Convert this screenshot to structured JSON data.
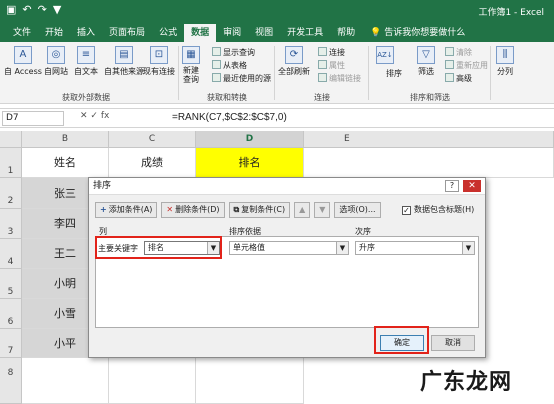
{
  "qat": {
    "save_icon": "save-icon",
    "undo_icon": "undo-icon",
    "redo_icon": "redo-icon",
    "filter_icon": "filter-icon"
  },
  "window": {
    "title": "工作簿1 - Excel"
  },
  "tabs": [
    "文件",
    "开始",
    "插入",
    "页面布局",
    "公式",
    "数据",
    "审阅",
    "视图",
    "开发工具",
    "帮助"
  ],
  "tell_me": "告诉我你想要做什么",
  "ribbon": {
    "get_external": {
      "items": [
        "自 Access",
        "自网站",
        "自文本",
        "自其他来源",
        "现有连接"
      ],
      "label": "获取外部数据"
    },
    "get_transform": {
      "new_query": "新建\n查询",
      "show_queries": "显示查询",
      "from_table": "从表格",
      "recent_sources": "最近使用的源",
      "label": "获取和转换"
    },
    "connections": {
      "refresh_all": "全部刷新",
      "connections": "连接",
      "properties": "属性",
      "edit_links": "编辑链接",
      "label": "连接"
    },
    "sort_filter": {
      "sort": "排序",
      "filter": "筛选",
      "clear": "清除",
      "reapply": "重新应用",
      "advanced": "高级",
      "label": "排序和筛选"
    },
    "split": "分列"
  },
  "formula_bar": {
    "name_box": "D7",
    "fx": "fx",
    "formula": "=RANK(C7,$C$2:$C$7,0)"
  },
  "sheet": {
    "columns": [
      "B",
      "C",
      "D",
      "E"
    ],
    "rows": [
      "1",
      "2",
      "3",
      "4",
      "5",
      "6",
      "7",
      "8"
    ],
    "header": [
      "姓名",
      "成绩",
      "排名"
    ],
    "names": [
      "张三",
      "李四",
      "王二",
      "小明",
      "小雪",
      "小平"
    ]
  },
  "dialog": {
    "title": "排序",
    "add_level": "添加条件(A)",
    "delete_level": "删除条件(D)",
    "copy_level": "复制条件(C)",
    "options": "选项(O)...",
    "has_headers": "数据包含标题(H)",
    "has_headers_checked": "✓",
    "col_header": "列",
    "sort_on_header": "排序依据",
    "order_header": "次序",
    "row_label": "主要关键字",
    "key_value": "排名",
    "sort_on_value": "单元格值",
    "order_value": "升序",
    "ok": "确定",
    "cancel": "取消"
  },
  "watermark": "广东龙网"
}
